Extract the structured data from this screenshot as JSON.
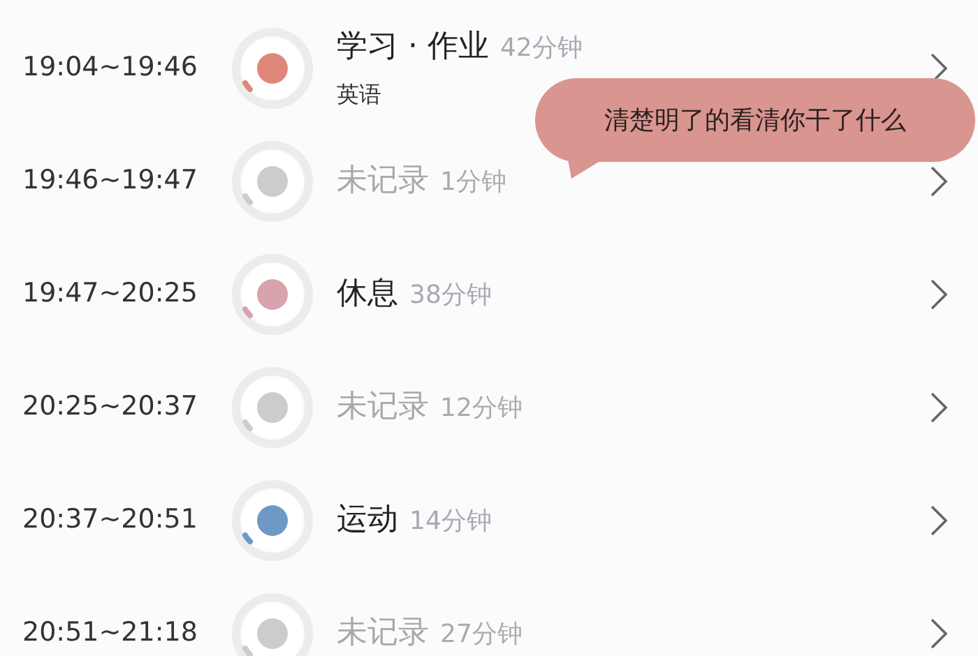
{
  "entries": [
    {
      "time": "19:04~19:46",
      "kind": "recorded",
      "title": "学习 · 作业",
      "duration": "42分钟",
      "subtitle": "英语",
      "color": "#e0877c"
    },
    {
      "time": "19:46~19:47",
      "kind": "unrecorded",
      "title": "未记录",
      "duration": "1分钟",
      "color": "#cccccc"
    },
    {
      "time": "19:47~20:25",
      "kind": "recorded",
      "title": "休息",
      "duration": "38分钟",
      "color": "#d8a3ad"
    },
    {
      "time": "20:25~20:37",
      "kind": "unrecorded",
      "title": "未记录",
      "duration": "12分钟",
      "color": "#cccccc"
    },
    {
      "time": "20:37~20:51",
      "kind": "recorded",
      "title": "运动",
      "duration": "14分钟",
      "color": "#6e98c6"
    },
    {
      "time": "20:51~21:18",
      "kind": "unrecorded",
      "title": "未记录",
      "duration": "27分钟",
      "color": "#cccccc"
    }
  ],
  "comment_bubble": {
    "text": "清楚明了的看清你干了什么"
  }
}
